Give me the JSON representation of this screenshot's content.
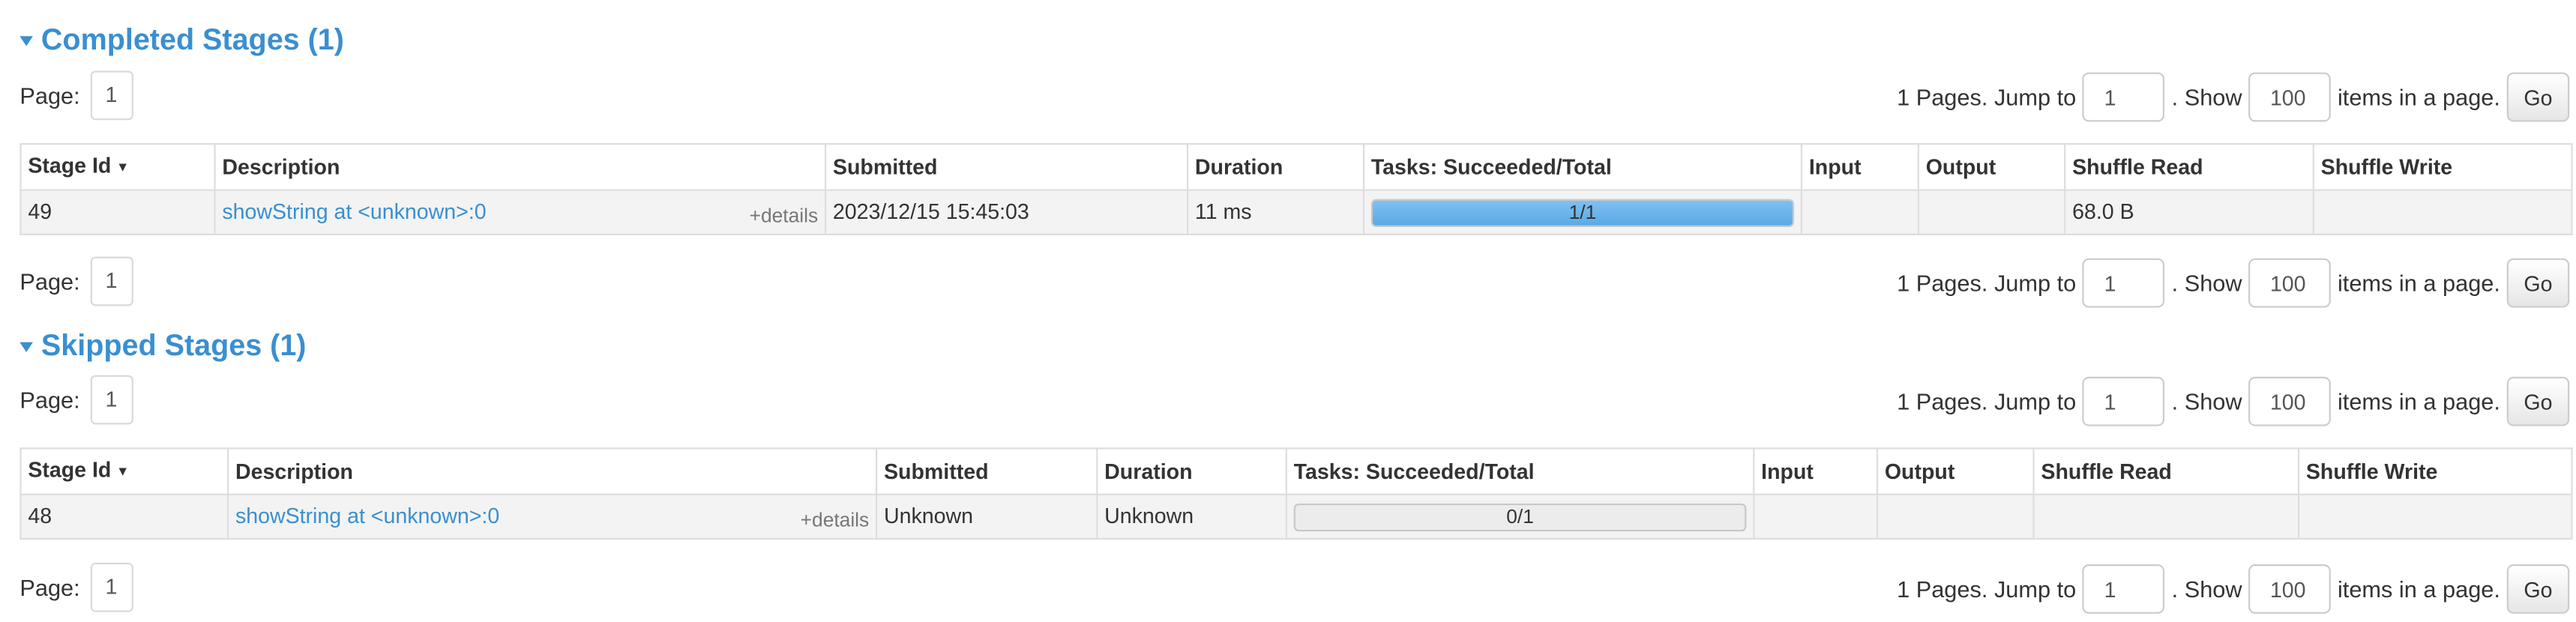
{
  "completed": {
    "header": "Completed Stages (1)",
    "pager": {
      "page_label": "Page:",
      "page_button": "1",
      "pages_text": "1 Pages. Jump to",
      "jump_value": "1",
      "show_text": ". Show",
      "show_value": "100",
      "items_text": "items in a page.",
      "go_label": "Go"
    },
    "columns": [
      "Stage Id",
      "Description",
      "Submitted",
      "Duration",
      "Tasks: Succeeded/Total",
      "Input",
      "Output",
      "Shuffle Read",
      "Shuffle Write"
    ],
    "row": {
      "stage_id": "49",
      "description": "showString at <unknown>:0",
      "details": "+details",
      "submitted": "2023/12/15 15:45:03",
      "duration": "11 ms",
      "tasks_text": "1/1",
      "tasks_fraction": 1.0,
      "input": "",
      "output": "",
      "shuffle_read": "68.0 B",
      "shuffle_write": ""
    }
  },
  "skipped": {
    "header": "Skipped Stages (1)",
    "pager": {
      "page_label": "Page:",
      "page_button": "1",
      "pages_text": "1 Pages. Jump to",
      "jump_value": "1",
      "show_text": ". Show",
      "show_value": "100",
      "items_text": "items in a page.",
      "go_label": "Go"
    },
    "columns": [
      "Stage Id",
      "Description",
      "Submitted",
      "Duration",
      "Tasks: Succeeded/Total",
      "Input",
      "Output",
      "Shuffle Read",
      "Shuffle Write"
    ],
    "row": {
      "stage_id": "48",
      "description": "showString at <unknown>:0",
      "details": "+details",
      "submitted": "Unknown",
      "duration": "Unknown",
      "tasks_text": "0/1",
      "tasks_fraction": 0.0,
      "input": "",
      "output": "",
      "shuffle_read": "",
      "shuffle_write": ""
    }
  },
  "colors": {
    "link": "#3a8fd0",
    "progress_fill": "#5aaae6",
    "row_bg": "#f3f3f3"
  },
  "icons": {
    "section_toggle": "caret-down-icon",
    "sort": "sort-desc-arrow-icon"
  }
}
